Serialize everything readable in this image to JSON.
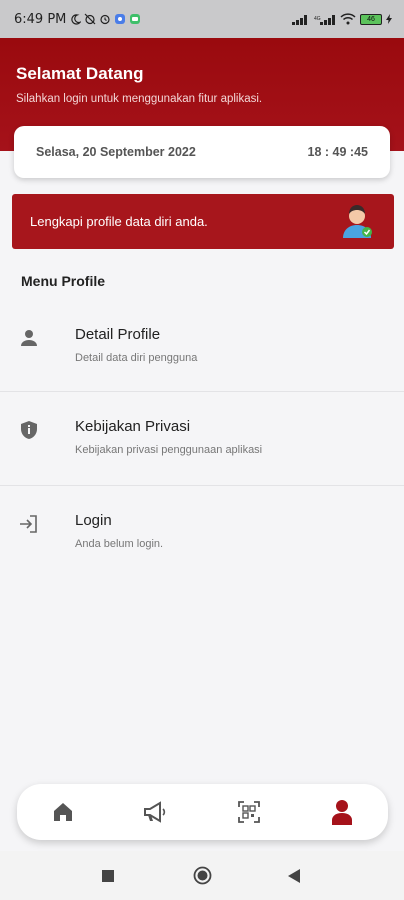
{
  "status_bar": {
    "time": "6:49 PM",
    "battery": "46"
  },
  "header": {
    "title": "Selamat Datang",
    "subtitle": "Silahkan login untuk menggunakan fitur aplikasi."
  },
  "date_card": {
    "date": "Selasa, 20 September 2022",
    "time": "18 : 49 :45"
  },
  "profile_banner": {
    "text": "Lengkapi profile data diri anda."
  },
  "menu": {
    "title": "Menu Profile",
    "items": [
      {
        "icon": "person-icon",
        "title": "Detail Profile",
        "subtitle": "Detail data diri pengguna"
      },
      {
        "icon": "shield-info-icon",
        "title": "Kebijakan Privasi",
        "subtitle": "Kebijakan privasi penggunaan aplikasi"
      },
      {
        "icon": "login-icon",
        "title": "Login",
        "subtitle": "Anda belum login."
      }
    ]
  },
  "bottom_nav": {
    "items": [
      {
        "icon": "home-icon"
      },
      {
        "icon": "megaphone-icon"
      },
      {
        "icon": "qr-scan-icon"
      },
      {
        "icon": "profile-icon",
        "active": true
      }
    ]
  },
  "colors": {
    "primary": "#a5121a",
    "nav_inactive": "#555555"
  }
}
